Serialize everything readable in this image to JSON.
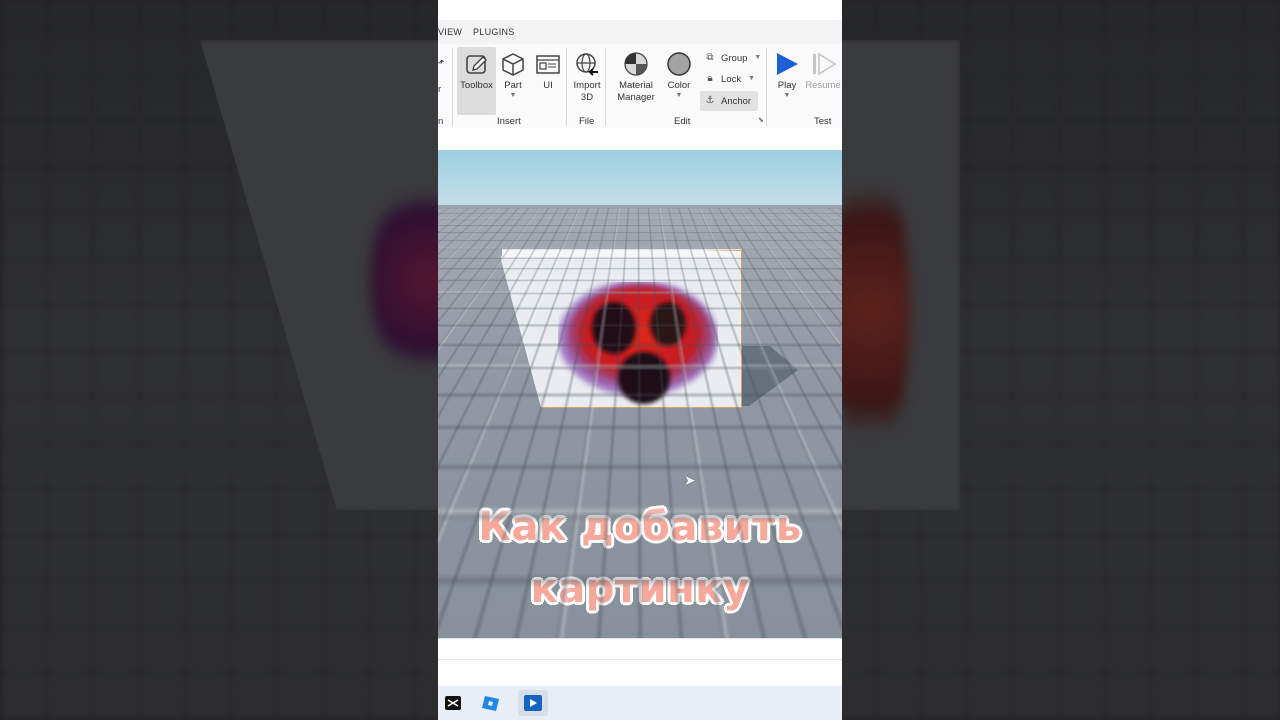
{
  "tabs": {
    "view": "VIEW",
    "plugins": "PLUGINS"
  },
  "ribbon": {
    "toolbox": "Toolbox",
    "part": "Part",
    "ui": "UI",
    "import3d_line1": "Import",
    "import3d_line2": "3D",
    "material_line1": "Material",
    "material_line2": "Manager",
    "color": "Color",
    "group": "Group",
    "lock": "Lock",
    "anchor": "Anchor",
    "play": "Play",
    "resume": "Resume"
  },
  "groups": {
    "insert": "Insert",
    "file": "File",
    "edit": "Edit",
    "test": "Test"
  },
  "caption": {
    "line1": "Как добавить",
    "line2": "картинку"
  },
  "colors": {
    "accent_blue": "#1e5fd6",
    "caption_text": "#f6a99a",
    "selection_outline": "#d9a15a"
  },
  "taskbar": {
    "apps": [
      "capcut-icon",
      "roblox-studio-icon",
      "video-player-icon"
    ]
  }
}
